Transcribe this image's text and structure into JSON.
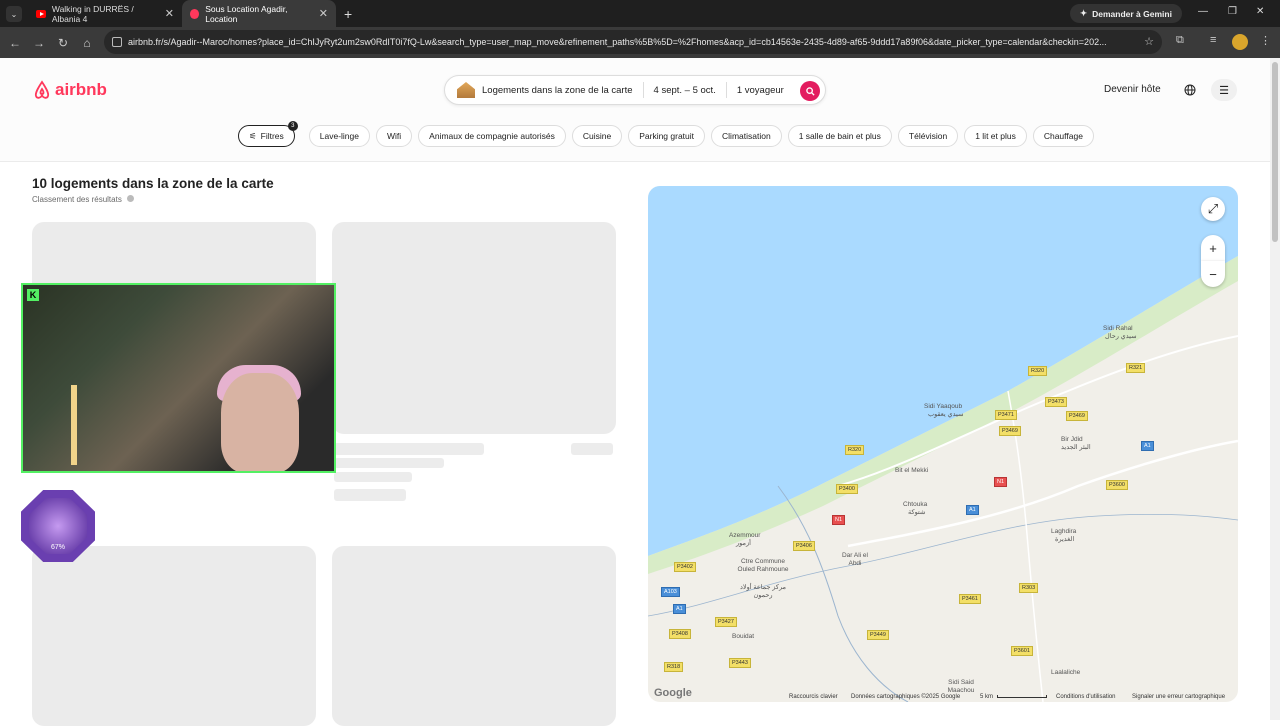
{
  "browser": {
    "tabs": [
      {
        "title": "Walking in DURRËS / Albania 4",
        "active": false
      },
      {
        "title": "Sous Location Agadir, Location",
        "active": true
      }
    ],
    "gemini_label": "Demander à Gemini",
    "url": "airbnb.fr/s/Agadir--Maroc/homes?place_id=ChIJyRyt2um2sw0RdIT0i7fQ-Lw&search_type=user_map_move&refinement_paths%5B%5D=%2Fhomes&acp_id=cb14563e-2435-4d89-af65-9ddd17a89f06&date_picker_type=calendar&checkin=202..."
  },
  "header": {
    "brand": "airbnb",
    "search": {
      "location": "Logements dans la zone de la carte",
      "dates": "4 sept. – 5 oct.",
      "guests": "1 voyageur"
    },
    "host_link": "Devenir hôte"
  },
  "filters": {
    "filters_label": "Filtres",
    "filters_count": "3",
    "chips": [
      "Lave-linge",
      "Wifi",
      "Animaux de compagnie autorisés",
      "Cuisine",
      "Parking gratuit",
      "Climatisation",
      "1 salle de bain et plus",
      "Télévision",
      "1 lit et plus",
      "Chauffage"
    ]
  },
  "results": {
    "title": "10 logements dans la zone de la carte",
    "subtitle": "Classement des résultats"
  },
  "map": {
    "places": [
      "Sidi Rahal",
      "سيدي رحال",
      "Sidi Yaaqoub",
      "سيدي يعقوب",
      "Bir Jdid",
      "البئر الجديد",
      "Bit el Mekki",
      "Chtouka",
      "شتوكة",
      "Azemmour",
      "أزمور",
      "Ctre Commune Ouled Rahmoune",
      "مركز جماعة أولاد رحمون",
      "Dar Ali el Abdi",
      "Laghdira",
      "الغديرة",
      "Bouidat",
      "Sidi Said Maachou",
      "Laalaliche"
    ],
    "roads": [
      "R320",
      "R321",
      "P3473",
      "P3471",
      "P3469",
      "P3469",
      "A1",
      "R320",
      "N1",
      "P3400",
      "P3600",
      "A1",
      "N1",
      "P3406",
      "P3402",
      "A103",
      "A1",
      "P3427",
      "P3461",
      "R303",
      "P3408",
      "P3449",
      "R318",
      "P3443",
      "P3601"
    ],
    "attribution": {
      "shortcuts": "Raccourcis clavier",
      "map_data": "Données cartographiques ©2025 Google",
      "scale": "5 km",
      "terms": "Conditions d'utilisation",
      "report": "Signaler une erreur cartographique",
      "google": "Google"
    }
  },
  "overlay": {
    "kick_logo": "K",
    "crystal_percent": "67%"
  }
}
